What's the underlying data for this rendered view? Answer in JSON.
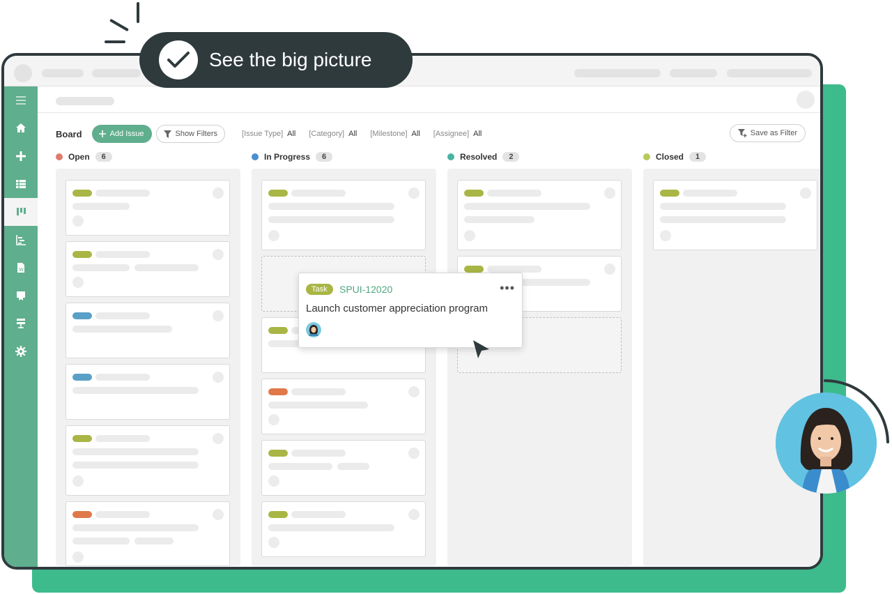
{
  "banner": {
    "text": "See  the big picture"
  },
  "toolbar": {
    "board_title": "Board",
    "add_issue": "Add Issue",
    "show_filters": "Show Filters",
    "save_as_filter": "Save as Filter",
    "filters": [
      {
        "label": "[Issue Type]",
        "value": "All"
      },
      {
        "label": "[Category]",
        "value": "All"
      },
      {
        "label": "[Milestone]",
        "value": "All"
      },
      {
        "label": "[Assignee]",
        "value": "All"
      }
    ]
  },
  "columns": [
    {
      "name": "Open",
      "count": "6",
      "color": "#e07a6a"
    },
    {
      "name": "In Progress",
      "count": "6",
      "color": "#4a8fcf"
    },
    {
      "name": "Resolved",
      "count": "2",
      "color": "#4ab3a0"
    },
    {
      "name": "Closed",
      "count": "1",
      "color": "#b9c95a"
    }
  ],
  "drag_card": {
    "type": "Task",
    "key": "SPUI-12020",
    "title": "Launch customer appreciation program",
    "menu": "•••"
  },
  "colors": {
    "brand_green": "#5fae8d",
    "background_green": "#3dbb8c",
    "dark": "#2f3a3d",
    "tag_olive": "#a9b645",
    "tag_blue": "#5a9fc6",
    "tag_orange": "#e0784a"
  },
  "icons": {
    "sidebar": [
      "menu-icon",
      "home-icon",
      "plus-icon",
      "list-icon",
      "board-icon",
      "gantt-icon",
      "wiki-icon",
      "files-icon",
      "git-icon",
      "settings-icon"
    ]
  }
}
